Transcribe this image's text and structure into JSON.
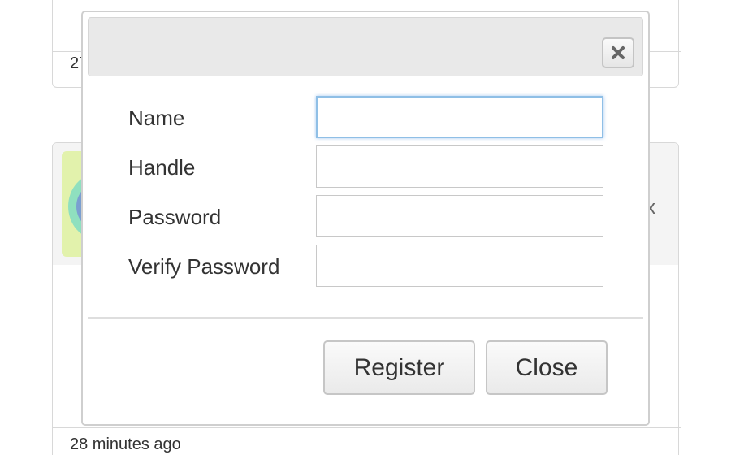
{
  "background": {
    "top_card_meta": "27",
    "mid_card_peek": "x",
    "mid_card_footer": "28 minutes ago"
  },
  "modal": {
    "close_icon": "close-icon",
    "fields": [
      {
        "label": "Name",
        "value": "",
        "placeholder": "",
        "focused": true
      },
      {
        "label": "Handle",
        "value": "",
        "placeholder": ""
      },
      {
        "label": "Password",
        "value": "",
        "placeholder": ""
      },
      {
        "label": "Verify Password",
        "value": "",
        "placeholder": ""
      }
    ],
    "buttons": {
      "register_label": "Register",
      "close_label": "Close"
    }
  },
  "colors": {
    "focus_ring": "#8fbfe6",
    "header_bg": "#e9e9e9",
    "text": "#333333"
  }
}
